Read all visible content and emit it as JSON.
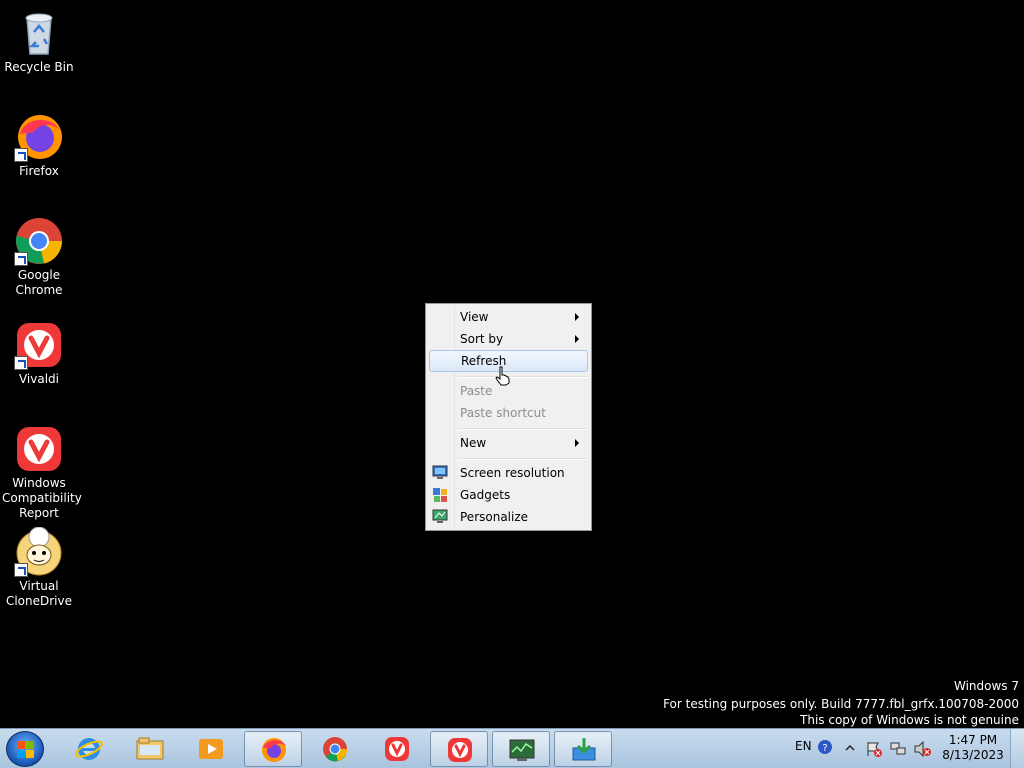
{
  "desktop_icons": [
    {
      "id": "recycle-bin",
      "label": "Recycle Bin"
    },
    {
      "id": "firefox",
      "label": "Firefox"
    },
    {
      "id": "google-chrome",
      "label": "Google Chrome"
    },
    {
      "id": "vivaldi",
      "label": "Vivaldi"
    },
    {
      "id": "windows-compat",
      "label": "Windows Compatibility Report"
    },
    {
      "id": "virtual-clonedrive",
      "label": "Virtual CloneDrive"
    }
  ],
  "context_menu": {
    "items": [
      {
        "label": "View",
        "submenu": true,
        "disabled": false
      },
      {
        "label": "Sort by",
        "submenu": true,
        "disabled": false
      },
      {
        "label": "Refresh",
        "submenu": false,
        "disabled": false,
        "hover": true
      },
      {
        "label": "Paste",
        "submenu": false,
        "disabled": true
      },
      {
        "label": "Paste shortcut",
        "submenu": false,
        "disabled": true
      },
      {
        "label": "New",
        "submenu": true,
        "disabled": false
      },
      {
        "label": "Screen resolution",
        "icon": "display-icon"
      },
      {
        "label": "Gadgets",
        "icon": "gadgets-icon"
      },
      {
        "label": "Personalize",
        "icon": "personalize-icon"
      }
    ]
  },
  "watermark": {
    "line1": "Windows 7",
    "line2": "For testing purposes only. Build 7777.fbl_grfx.100708-2000",
    "line3": "This copy of Windows is not genuine"
  },
  "taskbar": {
    "pinned": [
      "internet-explorer-icon",
      "windows-explorer-icon",
      "media-player-icon",
      "firefox-icon",
      "chrome-icon",
      "vivaldi-icon",
      "vivaldi-icon",
      "task-manager-icon",
      "installer-icon"
    ],
    "tray": {
      "language": "EN",
      "time": "1:47 PM",
      "date": "8/13/2023"
    }
  },
  "colors": {
    "taskbar_top": "#c9dcee",
    "menu_bg": "#f0f0f0",
    "menu_hover": "#dbe8f8",
    "disabled_text": "#8d8d8d"
  }
}
